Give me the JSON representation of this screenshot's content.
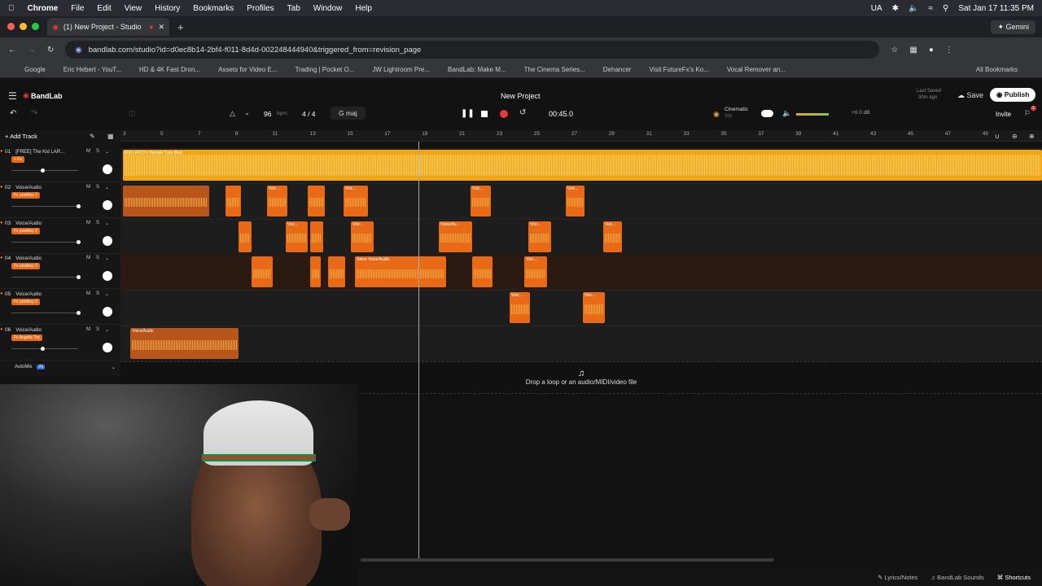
{
  "menubar": {
    "app": "Chrome",
    "items": [
      "File",
      "Edit",
      "View",
      "History",
      "Bookmarks",
      "Profiles",
      "Tab",
      "Window",
      "Help"
    ],
    "lang": "UA",
    "datetime": "Sat Jan 17  11:35 PM"
  },
  "tab": {
    "title": "(1) New Project - Studio"
  },
  "gemini": "Gemini",
  "address": {
    "url": "bandlab.com/studio?id=d0ec8b14-2bf4-f011-8d4d-002248444940&triggered_from=revision_page"
  },
  "bookmarks": [
    "Google",
    "Eric Hebert - YouT...",
    "HD & 4K Fast Dron...",
    "Assets for Video E...",
    "Trading | Pocket O...",
    "JW Lightroom Pre...",
    "BandLab: Make M...",
    "The Cinema Series...",
    "Dehancer",
    "Visit FutureFx's Ko...",
    "Vocal Remover an..."
  ],
  "all_bookmarks": "All Bookmarks",
  "studio": {
    "brand": "BandLab",
    "project_title": "New Project",
    "last_saved": "Last Saved",
    "saved_ago": "30m ago",
    "save_label": "Save",
    "publish_label": "Publish",
    "invite_label": "Invite",
    "tempo": "96",
    "tempo_unit": "bpm",
    "time_sig": "4 / 4",
    "key": "G maj",
    "time": "00:45.0",
    "preset": "Cinematic",
    "preset_sub": "100",
    "volume_db": "+0.0 dB",
    "add_track": "Add Track",
    "notification_count": "1",
    "playhead_bar": 18.9
  },
  "ruler": [
    "3",
    "5",
    "7",
    "9",
    "11",
    "13",
    "15",
    "17",
    "19",
    "21",
    "23",
    "25",
    "27",
    "29",
    "31",
    "33",
    "35",
    "37",
    "39",
    "41",
    "43",
    "45",
    "47",
    "49"
  ],
  "tracks": [
    {
      "num": "01",
      "name": "[FREE] The Kid LAR...",
      "fx": "+ Fx",
      "slider": 0.45,
      "clips": [
        {
          "label": "[Kid LAROI x Sample Type Beat",
          "s": 3,
          "e": 53,
          "kind": "beat"
        }
      ]
    },
    {
      "num": "02",
      "name": "Voice/Audio",
      "fx": "Fx poetboy 2",
      "slider": 1.0,
      "clips": [
        {
          "label": "",
          "s": 3,
          "e": 7.6
        },
        {
          "label": "",
          "s": 8.5,
          "e": 9.3
        },
        {
          "label": "Voic...",
          "s": 10.7,
          "e": 11.8
        },
        {
          "label": "",
          "s": 12.9,
          "e": 13.8
        },
        {
          "label": "Voic...",
          "s": 14.8,
          "e": 16.1
        },
        {
          "label": "Voic...",
          "s": 21.6,
          "e": 22.7
        },
        {
          "label": "Voic...",
          "s": 26.7,
          "e": 27.7
        }
      ]
    },
    {
      "num": "03",
      "name": "Voice/Audio",
      "fx": "Fx poetboy 2",
      "slider": 1.0,
      "clips": [
        {
          "label": "",
          "s": 9.2,
          "e": 9.9
        },
        {
          "label": "Voic...",
          "s": 11.7,
          "e": 12.9
        },
        {
          "label": "",
          "s": 13.0,
          "e": 13.7
        },
        {
          "label": "Voic...",
          "s": 15.2,
          "e": 16.4
        },
        {
          "label": "Voice/Au...",
          "s": 19.9,
          "e": 21.7
        },
        {
          "label": "Voic...",
          "s": 24.7,
          "e": 25.9
        },
        {
          "label": "Voic...",
          "s": 28.7,
          "e": 29.7
        }
      ]
    },
    {
      "num": "04",
      "name": "Voice/Audio",
      "fx": "Fx poetboy 2",
      "slider": 1.0,
      "clips": [
        {
          "label": "",
          "s": 9.9,
          "e": 11.0
        },
        {
          "label": "",
          "s": 13.0,
          "e": 13.6
        },
        {
          "label": "",
          "s": 14.0,
          "e": 14.9
        },
        {
          "label": "Takes   Voice/Audio",
          "s": 15.4,
          "e": 20.3
        },
        {
          "label": "",
          "s": 21.7,
          "e": 22.8
        },
        {
          "label": "Voic...",
          "s": 24.5,
          "e": 25.7
        }
      ]
    },
    {
      "num": "05",
      "name": "Voice/Audio",
      "fx": "Fx poetboy 2",
      "slider": 1.0,
      "clips": [
        {
          "label": "Voic...",
          "s": 23.7,
          "e": 24.8
        },
        {
          "label": "Voic...",
          "s": 27.6,
          "e": 28.8
        }
      ]
    },
    {
      "num": "06",
      "name": "Voice/Audio",
      "fx": "Fx Angelic Toy",
      "slider": 0.45,
      "clips": [
        {
          "label": "Voice/Audio",
          "s": 3.4,
          "e": 9.2
        }
      ]
    }
  ],
  "automix": "AutoMix",
  "automix_badge": "AI",
  "drop_text": "Drop a loop or an audio/MIDI/video file",
  "bottom": [
    "Lyrics/Notes",
    "BandLab Sounds",
    "Shortcuts"
  ],
  "colors": {
    "accent": "#e86a16",
    "beat": "#f2a516",
    "record": "#e53935"
  }
}
